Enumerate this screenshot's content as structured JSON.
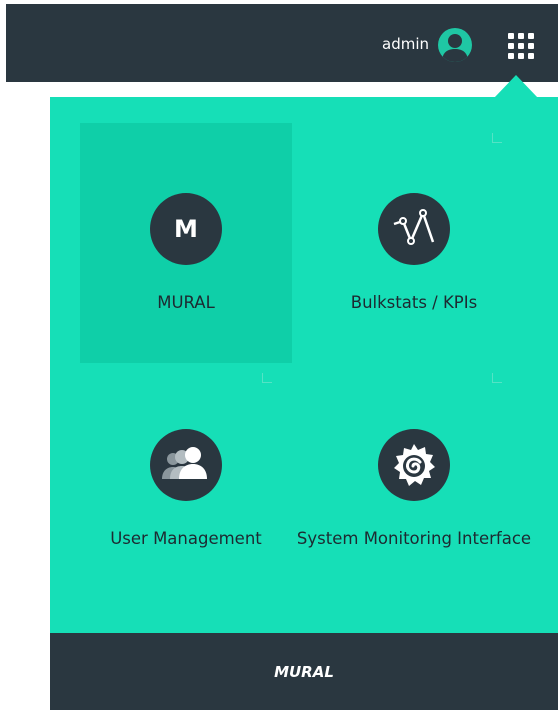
{
  "header": {
    "username": "admin",
    "avatar_icon": "user-avatar-icon",
    "apps_icon": "app-grid-icon"
  },
  "apps": [
    {
      "label": "MURAL",
      "icon": "mural-letter-icon",
      "icon_letter": "M",
      "selected": true
    },
    {
      "label": "Bulkstats / KPIs",
      "icon": "line-chart-icon",
      "selected": false
    },
    {
      "label": "User Management",
      "icon": "users-icon",
      "selected": false
    },
    {
      "label": "System Monitoring Interface",
      "icon": "grafana-icon",
      "selected": false
    }
  ],
  "footer": {
    "brand": "MURAL"
  },
  "colors": {
    "header_bg": "#2a3740",
    "panel_bg": "#16dfb7",
    "selected_tile_bg": "#0fcfa8",
    "icon_bg": "#2a3740",
    "text_dark": "#1d2a31"
  }
}
